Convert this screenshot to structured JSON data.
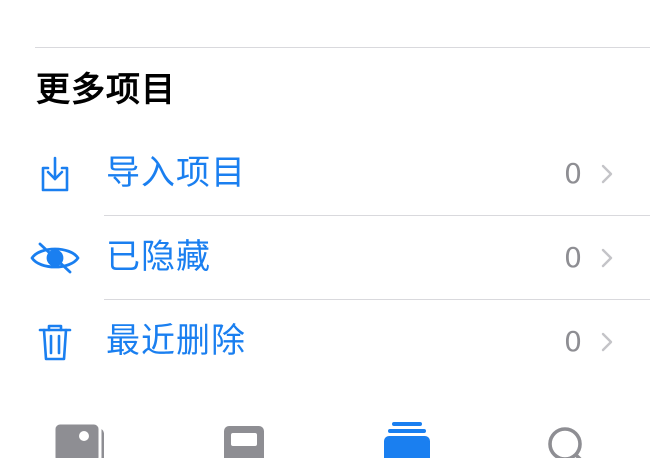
{
  "section": {
    "title": "更多项目"
  },
  "rows": [
    {
      "label": "导入项目",
      "count": "0",
      "icon": "import-icon"
    },
    {
      "label": "已隐藏",
      "count": "0",
      "icon": "eye-slash-icon"
    },
    {
      "label": "最近删除",
      "count": "0",
      "icon": "trash-icon"
    }
  ],
  "tabbar": {
    "tabs": [
      {
        "icon": "photos-tab-icon",
        "active": false
      },
      {
        "icon": "for-you-tab-icon",
        "active": false
      },
      {
        "icon": "albums-tab-icon",
        "active": true
      },
      {
        "icon": "search-tab-icon",
        "active": false
      }
    ]
  },
  "colors": {
    "accent": "#1a7ff0",
    "secondary_text": "#8e8e93",
    "inactive_tab": "#8e8e93",
    "divider": "#d9d9dd"
  }
}
